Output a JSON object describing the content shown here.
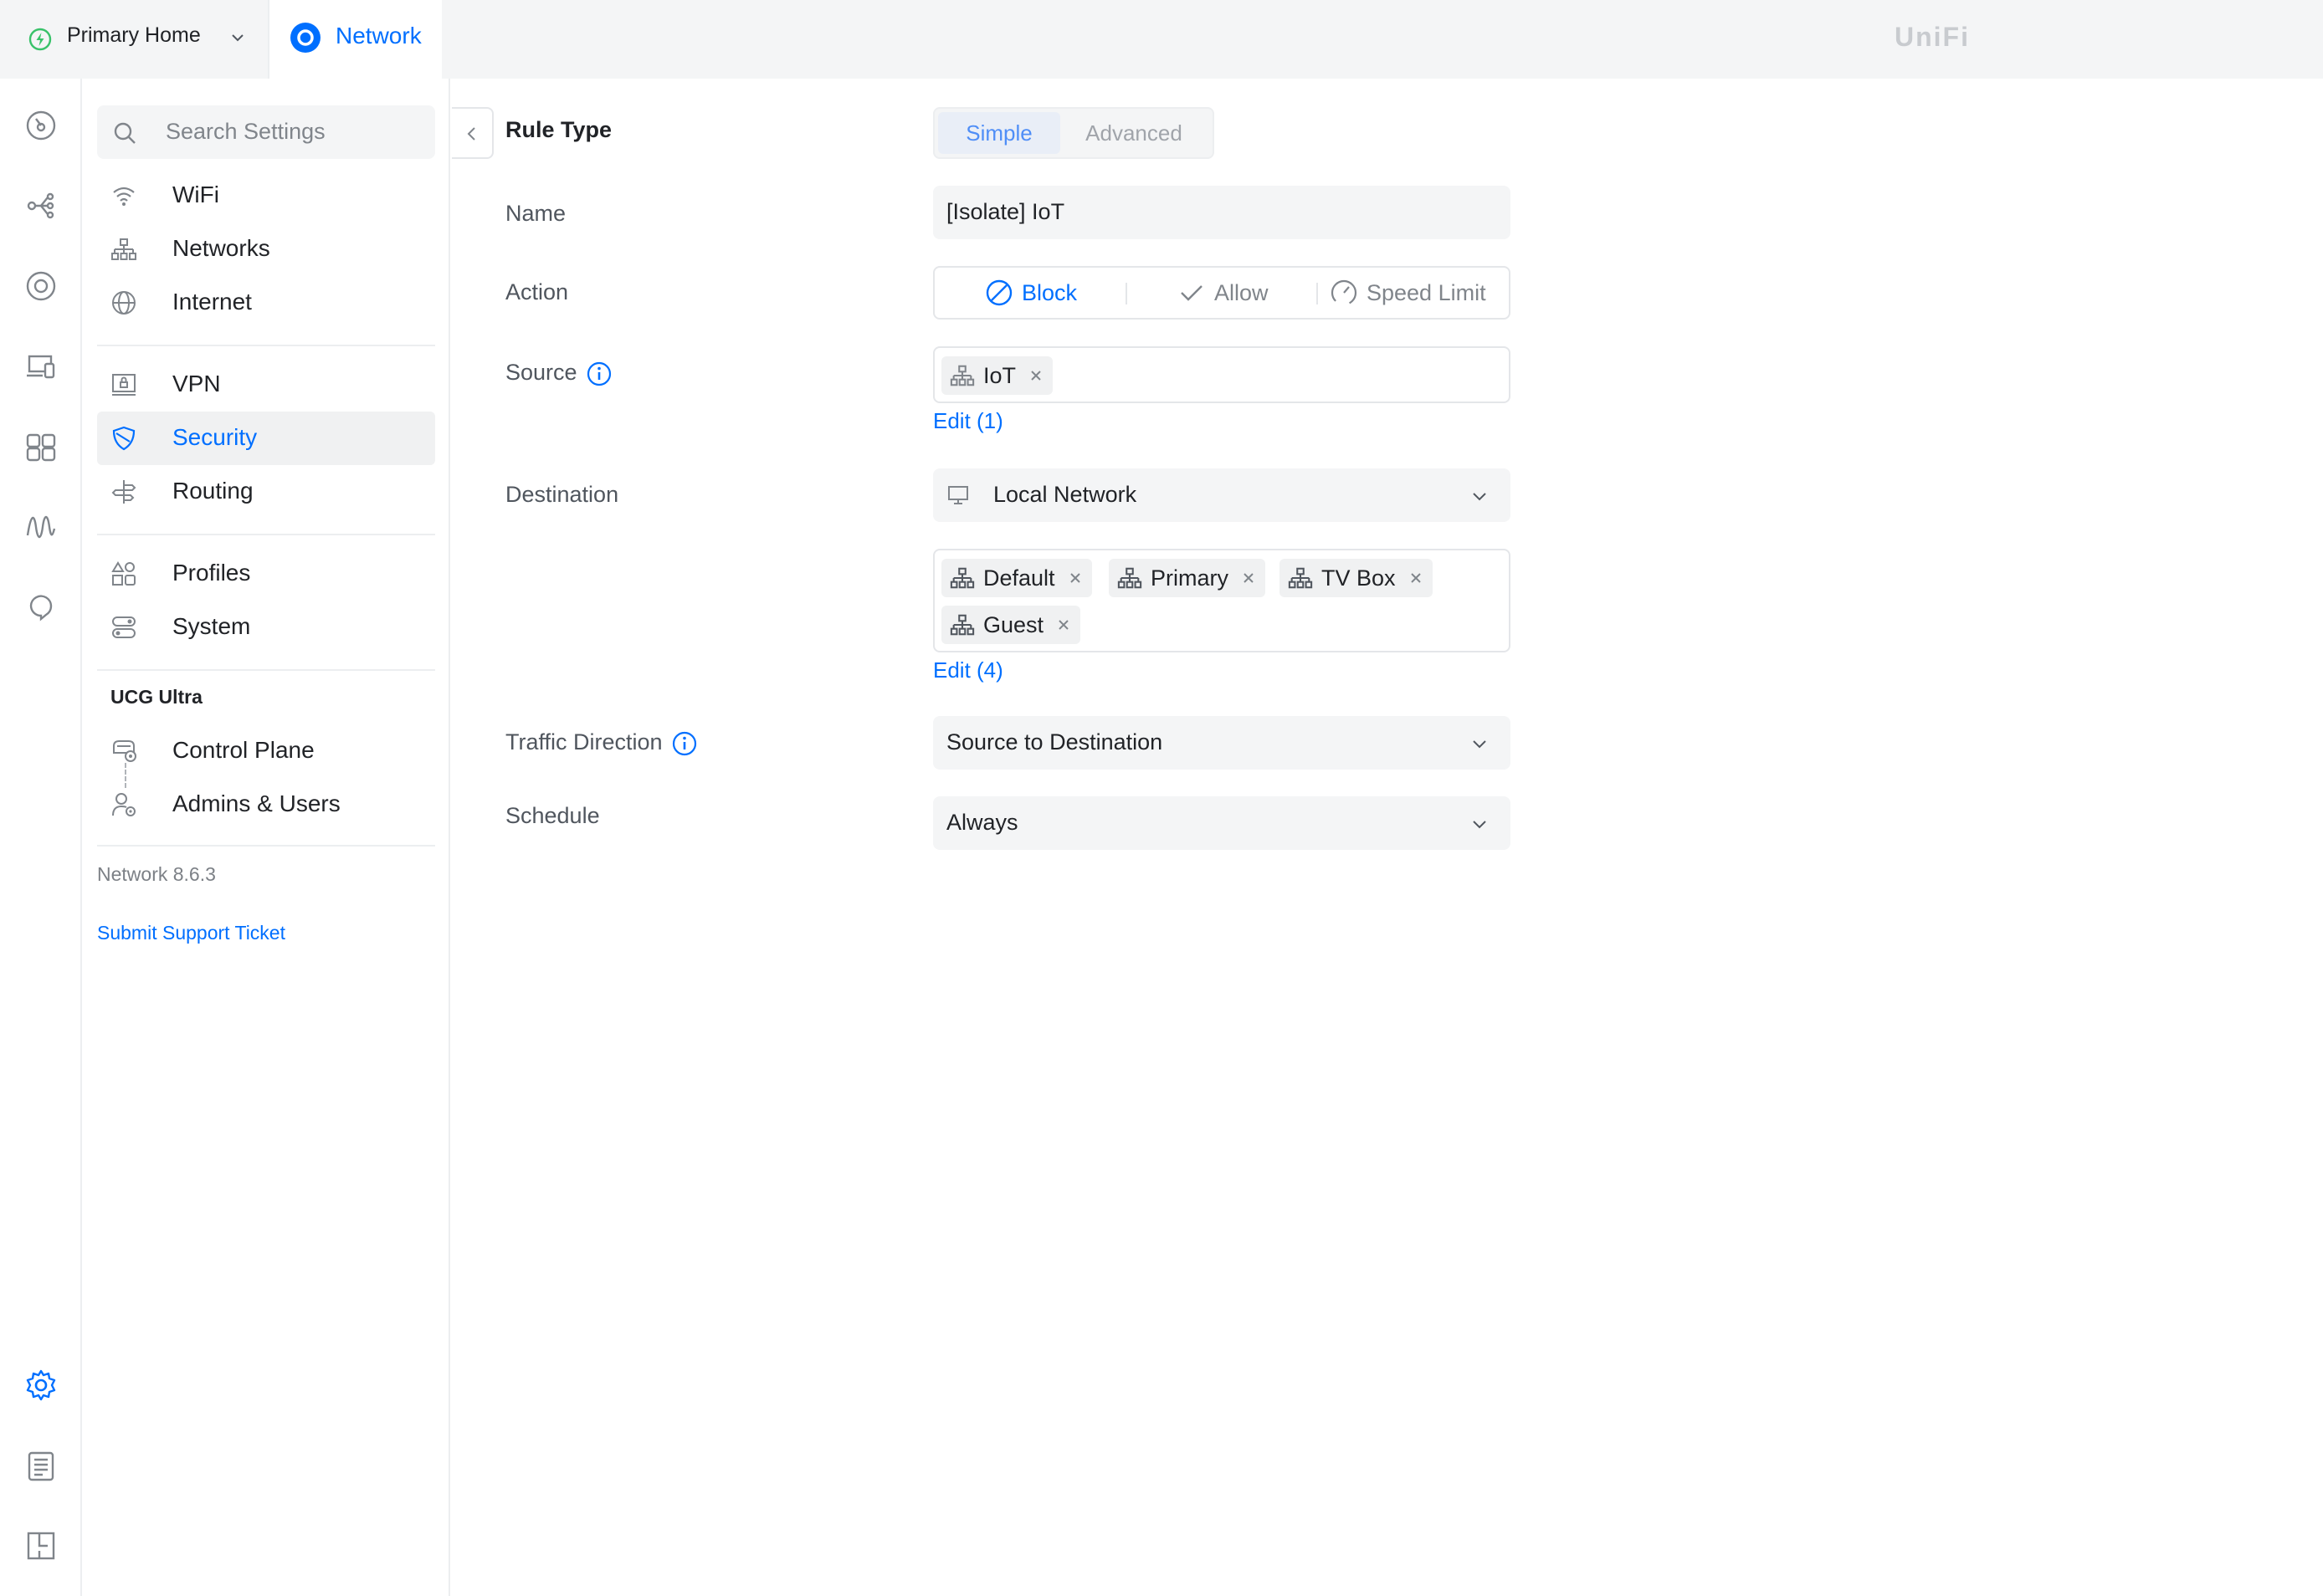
{
  "topbar": {
    "site_name": "Primary Home",
    "app_name": "Network",
    "brand": "UniFi"
  },
  "rail": {
    "items": [
      "dashboard-icon",
      "topology-icon",
      "unifi-devices-icon",
      "client-devices-icon",
      "insights-icon",
      "traffic-icon",
      "innerspace-icon"
    ],
    "bottom_items": [
      "settings-icon",
      "logs-icon",
      "floorplan-icon"
    ]
  },
  "sidebar": {
    "search_placeholder": "Search Settings",
    "items": [
      {
        "label": "WiFi",
        "icon": "wifi-icon"
      },
      {
        "label": "Networks",
        "icon": "networks-icon"
      },
      {
        "label": "Internet",
        "icon": "globe-icon"
      },
      {
        "label": "VPN",
        "icon": "vpn-icon"
      },
      {
        "label": "Security",
        "icon": "shield-icon",
        "active": true
      },
      {
        "label": "Routing",
        "icon": "routing-icon"
      },
      {
        "label": "Profiles",
        "icon": "profiles-icon"
      },
      {
        "label": "System",
        "icon": "system-icon"
      }
    ],
    "section_title": "UCG Ultra",
    "device_items": [
      {
        "label": "Control Plane",
        "icon": "gateway-icon"
      },
      {
        "label": "Admins & Users",
        "icon": "admins-icon"
      }
    ],
    "version": "Network 8.6.3",
    "support_link": "Submit Support Ticket"
  },
  "form": {
    "rule_type_label": "Rule Type",
    "rule_type_options": [
      "Simple",
      "Advanced"
    ],
    "rule_type_selected": "Simple",
    "name_label": "Name",
    "name_value": "[Isolate] IoT",
    "action_label": "Action",
    "action_options": [
      "Block",
      "Allow",
      "Speed Limit"
    ],
    "action_selected": "Block",
    "source_label": "Source",
    "source_chips": [
      "IoT"
    ],
    "source_edit": "Edit (1)",
    "destination_label": "Destination",
    "destination_type": "Local Network",
    "destination_chips": [
      "Default",
      "Primary",
      "TV Box",
      "Guest"
    ],
    "destination_edit": "Edit (4)",
    "traffic_direction_label": "Traffic Direction",
    "traffic_direction_value": "Source to Destination",
    "schedule_label": "Schedule",
    "schedule_value": "Always"
  },
  "colors": {
    "accent": "#006fff",
    "text": "#212327",
    "muted": "#80858b",
    "surface": "#f4f5f6"
  }
}
